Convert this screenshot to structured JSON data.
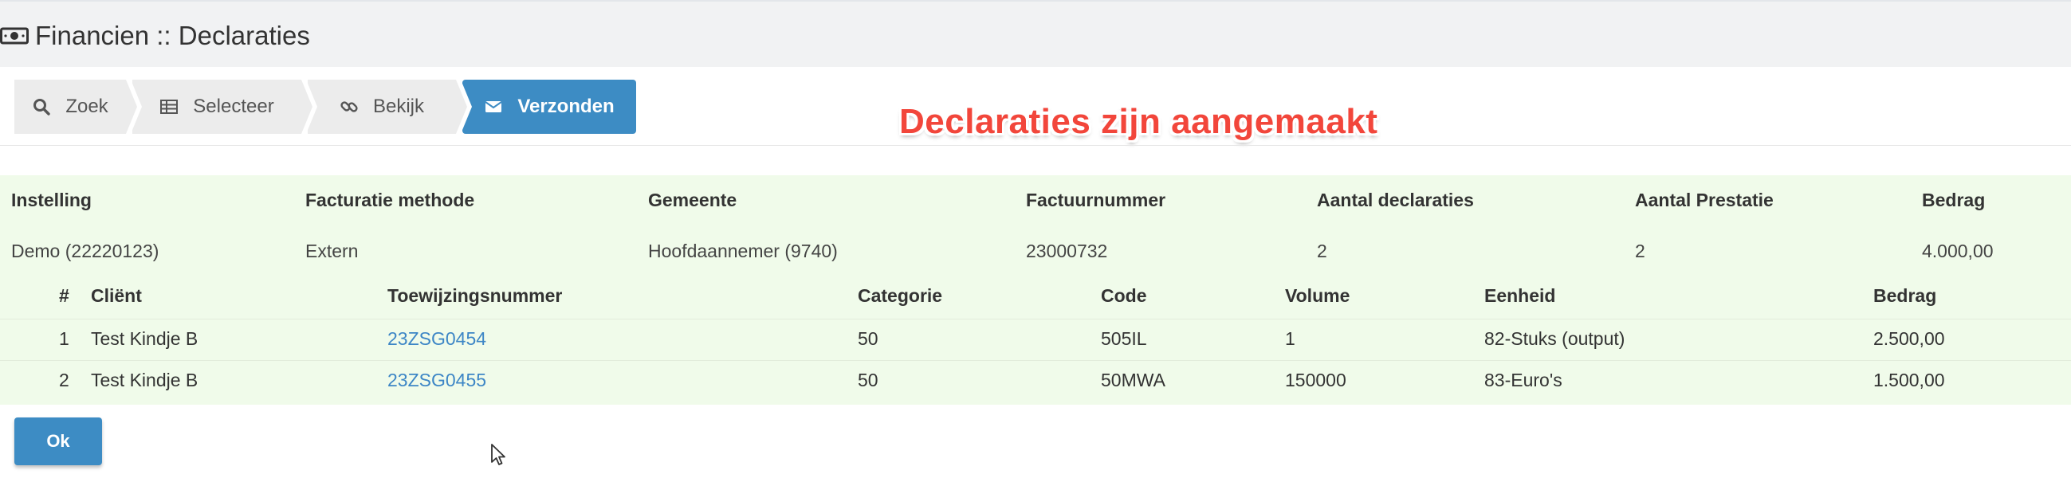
{
  "header": {
    "title": "Financien :: Declaraties",
    "icon": "money-icon"
  },
  "wizard": {
    "steps": [
      {
        "label": "Zoek",
        "icon": "search-icon"
      },
      {
        "label": "Selecteer",
        "icon": "table-icon"
      },
      {
        "label": "Bekijk",
        "icon": "link-icon"
      },
      {
        "label": "Verzonden",
        "icon": "envelope-icon"
      }
    ],
    "active_index": 3,
    "active_color": "#3d8cc4"
  },
  "overlay_message": "Declaraties zijn aangemaakt",
  "overlay_color": "#f2463b",
  "summary": {
    "headers": {
      "instelling": "Instelling",
      "facturatie_methode": "Facturatie methode",
      "gemeente": "Gemeente",
      "factuurnummer": "Factuurnummer",
      "aantal_declaraties": "Aantal declaraties",
      "aantal_prestatie": "Aantal Prestatie",
      "bedrag": "Bedrag"
    },
    "values": {
      "instelling": "Demo (22220123)",
      "facturatie_methode": "Extern",
      "gemeente": "Hoofdaannemer (9740)",
      "factuurnummer": "23000732",
      "aantal_declaraties": "2",
      "aantal_prestatie": "2",
      "bedrag": "4.000,00"
    }
  },
  "detail": {
    "headers": {
      "nr": "#",
      "client": "Cliënt",
      "toewijzingsnummer": "Toewijzingsnummer",
      "categorie": "Categorie",
      "code": "Code",
      "volume": "Volume",
      "eenheid": "Eenheid",
      "bedrag": "Bedrag"
    },
    "rows": [
      {
        "nr": "1",
        "client": "Test Kindje B",
        "toewijzingsnummer": "23ZSG0454",
        "categorie": "50",
        "code": "505IL",
        "volume": "1",
        "eenheid": "82-Stuks (output)",
        "bedrag": "2.500,00"
      },
      {
        "nr": "2",
        "client": "Test Kindje B",
        "toewijzingsnummer": "23ZSG0455",
        "categorie": "50",
        "code": "50MWA",
        "volume": "150000",
        "eenheid": "83-Euro's",
        "bedrag": "1.500,00"
      }
    ]
  },
  "footer": {
    "ok_label": "Ok"
  },
  "colors": {
    "summary_bg": "#f0fbea",
    "link": "#3d86c6",
    "header_bg": "#f1f2f3"
  }
}
